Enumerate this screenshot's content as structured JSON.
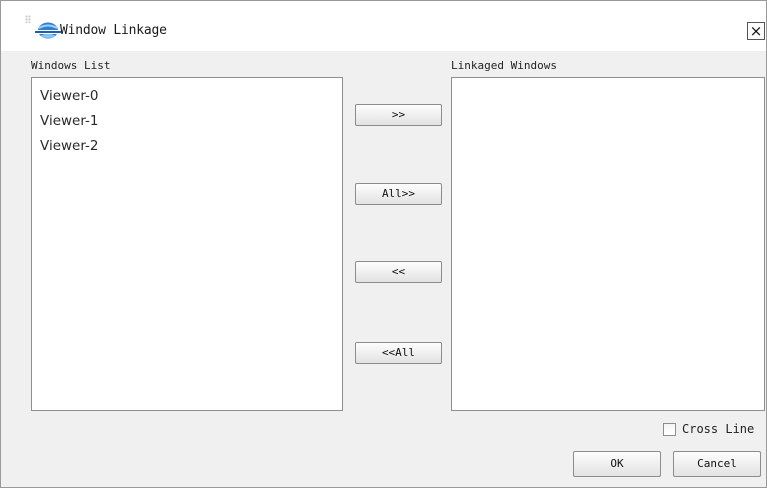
{
  "window": {
    "title": "Window Linkage",
    "close_glyph": "×",
    "logo_icon": "app-logo-icon"
  },
  "windows_list": {
    "label": "Windows List",
    "items": [
      "Viewer-0",
      "Viewer-1",
      "Viewer-2"
    ]
  },
  "linkaged_windows": {
    "label": "Linkaged Windows",
    "items": []
  },
  "transfer_buttons": {
    "add": ">>",
    "add_all": "All>>",
    "remove": "<<",
    "remove_all": "<<All"
  },
  "options": {
    "cross_line_label": "Cross Line",
    "cross_line_checked": false
  },
  "footer": {
    "ok_label": "OK",
    "cancel_label": "Cancel"
  }
}
